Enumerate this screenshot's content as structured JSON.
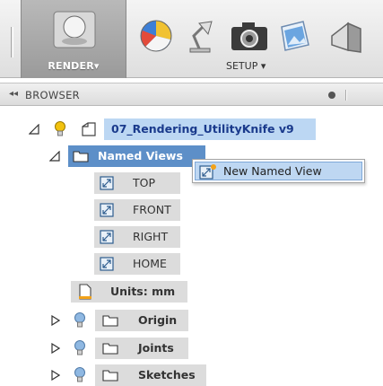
{
  "toolbar": {
    "workspace_label": "RENDER▾",
    "setup_label": "SETUP ▾",
    "tools": [
      "appearance-icon",
      "scene-settings-lamp-icon",
      "camera-icon",
      "decal-icon",
      "texture-map-icon"
    ]
  },
  "browser": {
    "title": "BROWSER",
    "collapse_glyph": "◂◂",
    "root": {
      "label": "07_Rendering_UtilityKnife v9"
    },
    "named_views": {
      "label": "Named Views",
      "items": [
        "TOP",
        "FRONT",
        "RIGHT",
        "HOME"
      ]
    },
    "units": {
      "label": "Units: mm"
    },
    "folders": [
      "Origin",
      "Joints",
      "Sketches"
    ]
  },
  "context_menu": {
    "item": "New Named View"
  },
  "colors": {
    "selection_light": "#bcd7f3",
    "selection_dark": "#5d8fc8",
    "root_text": "#1a3a8c",
    "render_group_bg": "#a8a8a8",
    "bulb_yellow": "#f2c20e",
    "bulb_blue": "#8fb8e2"
  }
}
